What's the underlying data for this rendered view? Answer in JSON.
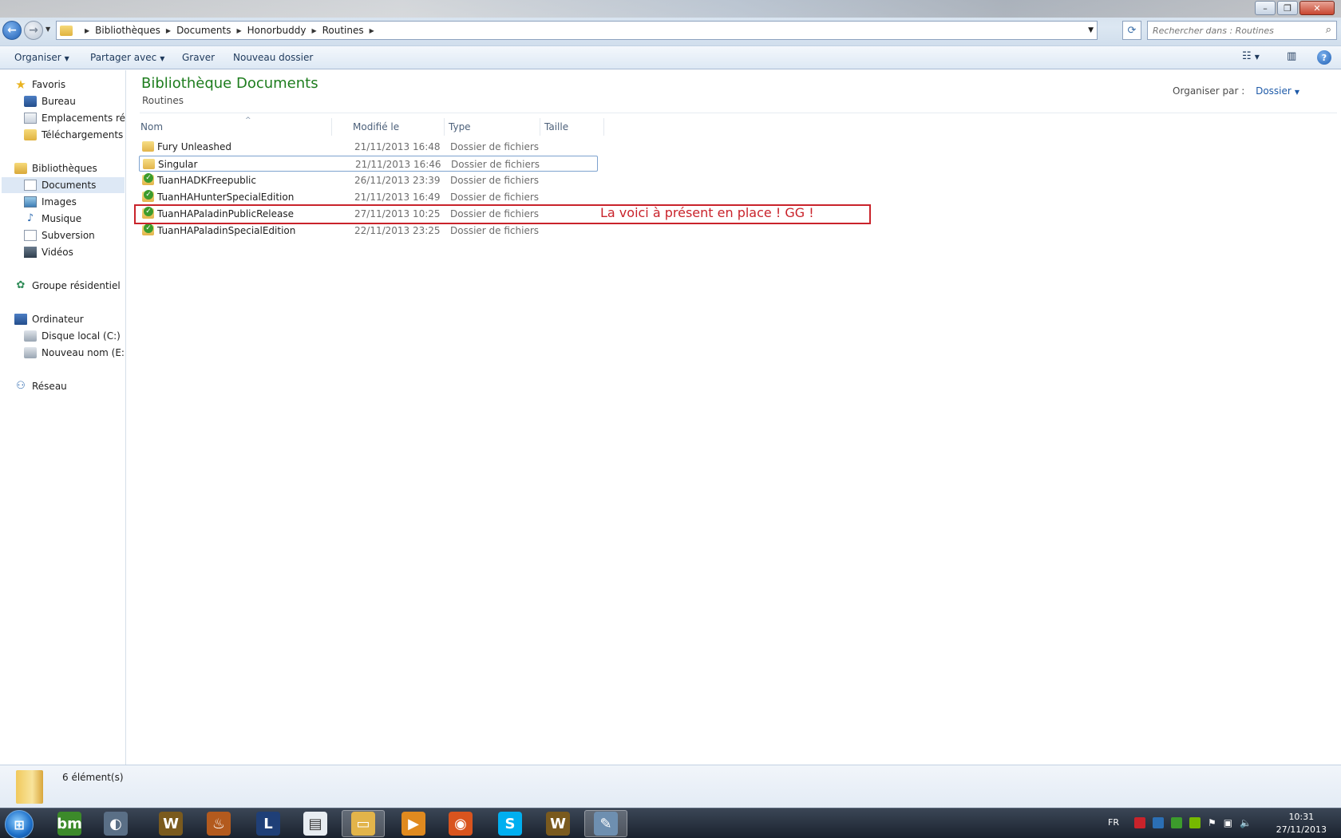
{
  "window": {
    "controls": {
      "minimize": "–",
      "maximize": "❐",
      "close": "✕"
    }
  },
  "address": {
    "crumbs": [
      "Bibliothèques",
      "Documents",
      "Honorbuddy",
      "Routines"
    ]
  },
  "search": {
    "placeholder": "Rechercher dans : Routines"
  },
  "toolbar": {
    "organize": "Organiser",
    "share": "Partager avec",
    "burn": "Graver",
    "new_folder": "Nouveau dossier"
  },
  "sidebar": {
    "favorites": "Favoris",
    "favorites_items": [
      "Bureau",
      "Emplacements récents",
      "Téléchargements"
    ],
    "libraries": "Bibliothèques",
    "libraries_items": [
      "Documents",
      "Images",
      "Musique",
      "Subversion",
      "Vidéos"
    ],
    "homegroup": "Groupe résidentiel",
    "computer": "Ordinateur",
    "computer_items": [
      "Disque local (C:)",
      "Nouveau nom (E:)"
    ],
    "network": "Réseau"
  },
  "library": {
    "title": "Bibliothèque Documents",
    "subtitle": "Routines",
    "arrange_label": "Organiser par :",
    "arrange_value": "Dossier"
  },
  "columns": {
    "name": "Nom",
    "modified": "Modifié le",
    "type": "Type",
    "size": "Taille"
  },
  "files": [
    {
      "name": "Fury Unleashed",
      "modified": "21/11/2013 16:48",
      "type": "Dossier de fichiers",
      "icon": "folder-icon"
    },
    {
      "name": "Singular",
      "modified": "21/11/2013 16:46",
      "type": "Dossier de fichiers",
      "icon": "folder-icon"
    },
    {
      "name": "TuanHADKFreepublic",
      "modified": "26/11/2013 23:39",
      "type": "Dossier de fichiers",
      "icon": "svn-folder-icon"
    },
    {
      "name": "TuanHAHunterSpecialEdition",
      "modified": "21/11/2013 16:49",
      "type": "Dossier de fichiers",
      "icon": "svn-folder-icon"
    },
    {
      "name": "TuanHAPaladinPublicRelease",
      "modified": "27/11/2013 10:25",
      "type": "Dossier de fichiers",
      "icon": "svn-folder-icon"
    },
    {
      "name": "TuanHAPaladinSpecialEdition",
      "modified": "22/11/2013 23:25",
      "type": "Dossier de fichiers",
      "icon": "svn-folder-icon"
    }
  ],
  "annotation": {
    "text": "La voici à présent en place ! GG !",
    "color": "#c9232b"
  },
  "status": {
    "count": "6 élément(s)"
  },
  "taskbar": {
    "buttons": [
      {
        "name": "bm",
        "label": "bm",
        "color": "#3c8a2a"
      },
      {
        "name": "app",
        "label": "◐",
        "color": "#5a6f86"
      },
      {
        "name": "wow-launcher",
        "label": "W",
        "color": "#7a5a1e"
      },
      {
        "name": "hearthstone",
        "label": "♨",
        "color": "#b35a1e"
      },
      {
        "name": "league",
        "label": "L",
        "color": "#1f3f77"
      },
      {
        "name": "notepad",
        "label": "▤",
        "color": "#e8edf2"
      },
      {
        "name": "explorer",
        "label": "▭",
        "color": "#e2b44a"
      },
      {
        "name": "media-player",
        "label": "▶",
        "color": "#e08a1f"
      },
      {
        "name": "firefox",
        "label": "◉",
        "color": "#d9541e"
      },
      {
        "name": "skype",
        "label": "S",
        "color": "#00aff0"
      },
      {
        "name": "wow",
        "label": "W",
        "color": "#7a5a1e"
      },
      {
        "name": "paint",
        "label": "✎",
        "color": "#6e8fb0"
      }
    ],
    "language": "FR",
    "time": "10:31",
    "date": "27/11/2013"
  }
}
